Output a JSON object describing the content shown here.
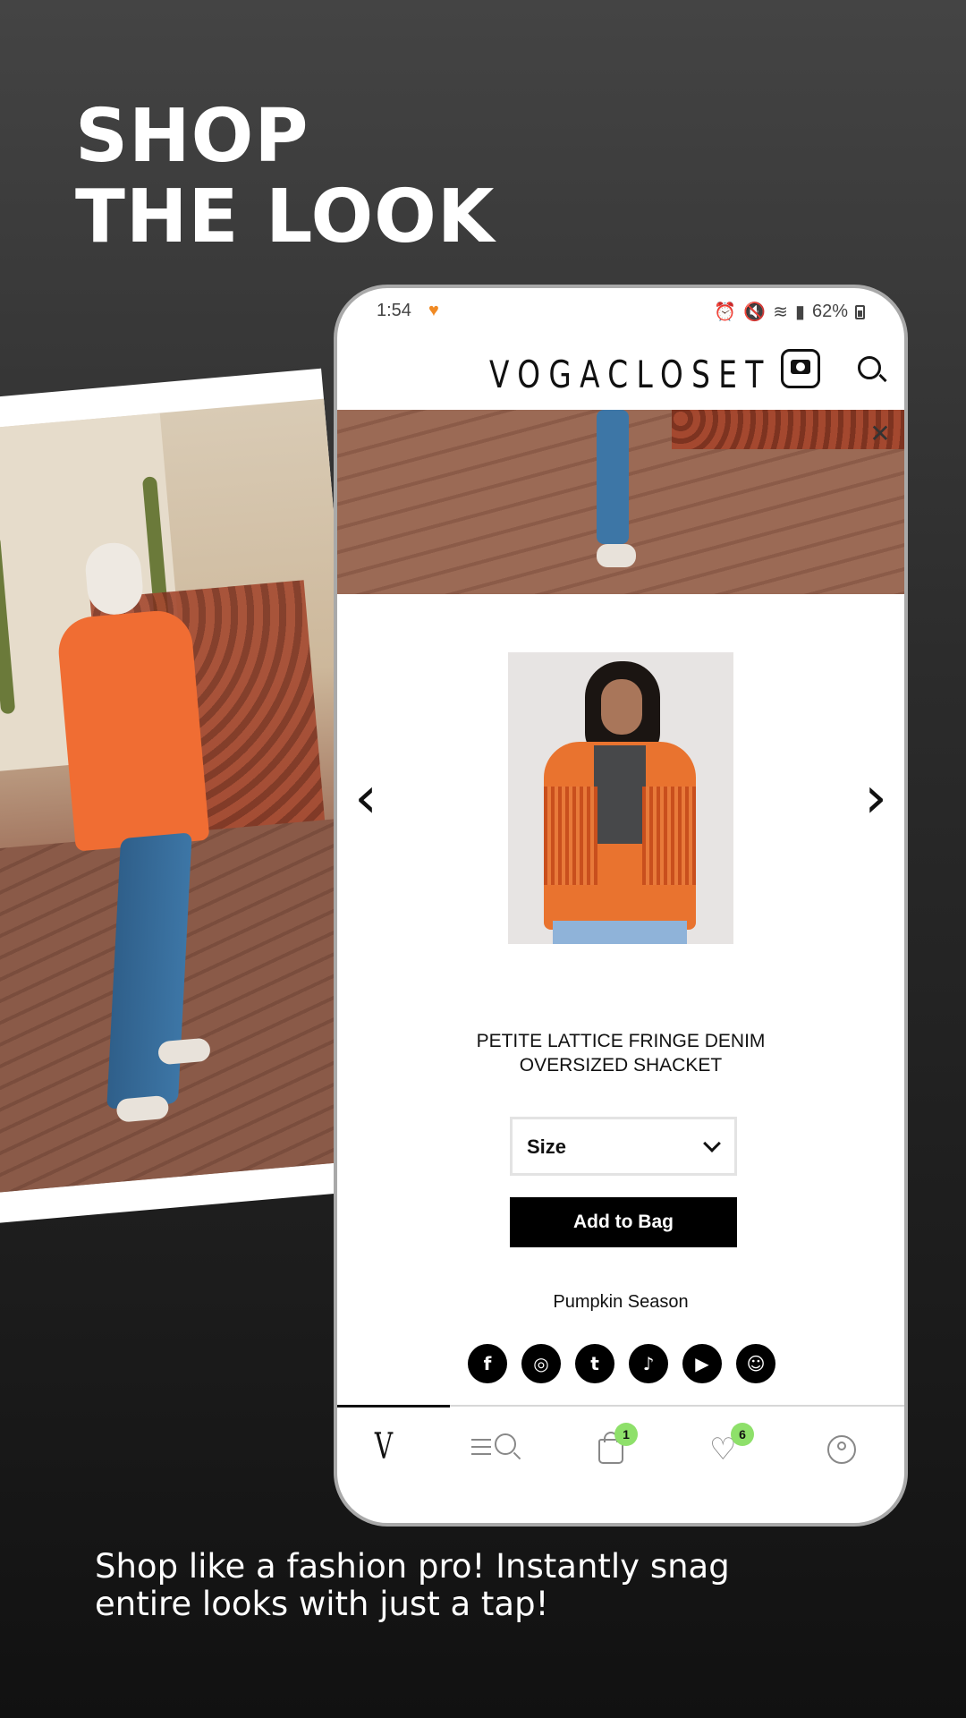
{
  "promo": {
    "headline_line1": "SHOP",
    "headline_line2": "THE LOOK",
    "tagline": "Shop like a fashion pro! Instantly snag entire looks with just a tap!"
  },
  "status_bar": {
    "time": "1:54",
    "battery": "62%",
    "icons": [
      "alarm-icon",
      "mute-icon",
      "wifi-icon",
      "signal-icon",
      "battery-icon"
    ]
  },
  "app_bar": {
    "brand": "VOGACLOSET",
    "camera_icon": "camera-search-icon",
    "search_icon": "search-icon"
  },
  "product": {
    "title": "PETITE LATTICE FRINGE DENIM OVERSIZED SHACKET",
    "size_select": {
      "value": "Size"
    },
    "add_to_bag_label": "Add to Bag"
  },
  "carousel": {
    "prev_icon": "chevron-left-icon",
    "next_icon": "chevron-right-icon"
  },
  "collection": {
    "name": "Pumpkin Season"
  },
  "socials": [
    {
      "name": "facebook-icon",
      "glyph": "f"
    },
    {
      "name": "instagram-icon",
      "glyph": "◎"
    },
    {
      "name": "twitter-icon",
      "glyph": "t"
    },
    {
      "name": "tiktok-icon",
      "glyph": "♪"
    },
    {
      "name": "youtube-icon",
      "glyph": "▶"
    },
    {
      "name": "snapchat-icon",
      "glyph": "☺"
    }
  ],
  "tab_bar": {
    "home": "V",
    "bag_count": "1",
    "wishlist_count": "6"
  },
  "colors": {
    "accent_badge": "#8ee06a",
    "button_bg": "#000000",
    "jacket_orange": "#f06d33"
  }
}
